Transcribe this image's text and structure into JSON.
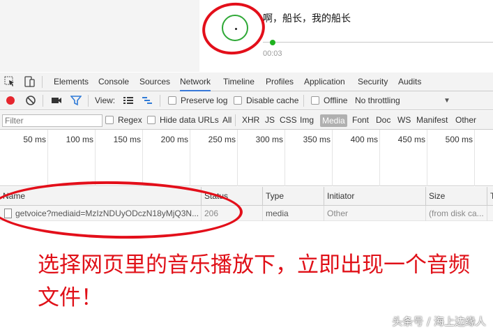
{
  "player": {
    "song_title": "啊，船长，我的船长",
    "time": "00:03",
    "accent": "#2ea836",
    "progress_fraction": 0.03
  },
  "devtools": {
    "tabs": [
      "Elements",
      "Console",
      "Sources",
      "Network",
      "Timeline",
      "Profiles",
      "Application",
      "Security",
      "Audits"
    ],
    "active_tab": "Network",
    "icons": {
      "inspect": "cursor-icon",
      "device": "device-icon"
    },
    "toolbar": {
      "record_icon": "record-icon",
      "clear_icon": "clear-icon",
      "camera_icon": "camera-icon",
      "filter_icon": "filter-icon",
      "view_label": "View:",
      "preserve_log": "Preserve log",
      "disable_cache": "Disable cache",
      "offline": "Offline",
      "throttling": "No throttling",
      "dropdown_glyph": "▼"
    },
    "filterbar": {
      "placeholder": "Filter",
      "regex": "Regex",
      "hide_data_urls": "Hide data URLs",
      "types": [
        "All",
        "XHR",
        "JS",
        "CSS",
        "Img",
        "Media",
        "Font",
        "Doc",
        "WS",
        "Manifest",
        "Other"
      ],
      "active_type": "Media"
    },
    "timeline_ticks": [
      "50 ms",
      "100 ms",
      "150 ms",
      "200 ms",
      "250 ms",
      "300 ms",
      "350 ms",
      "400 ms",
      "450 ms",
      "500 ms"
    ],
    "table": {
      "columns": [
        "Name",
        "Status",
        "Type",
        "Initiator",
        "Size",
        "T"
      ],
      "rows": [
        {
          "name": "getvoice?mediaid=MzIzNDUyODczN18yMjQ3N...",
          "status": "206",
          "type": "media",
          "initiator": "Other",
          "size": "(from disk ca..."
        }
      ]
    }
  },
  "annotation": {
    "text": "选择网页里的音乐播放下，立即出现一个音频文件！",
    "color": "#e01018"
  },
  "watermark": "头条号 / 海上边缘人"
}
